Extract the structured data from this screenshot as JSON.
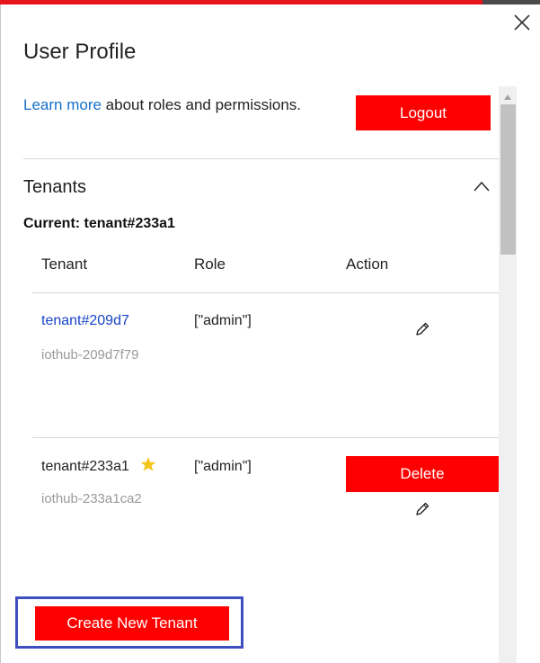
{
  "panel": {
    "title": "User Profile",
    "close_icon": "close-icon",
    "accent_red": "#ff0000",
    "link_blue": "#1570c9"
  },
  "intro": {
    "link_text": "Learn more",
    "text": " about roles and permissions.",
    "logout_label": "Logout"
  },
  "tenants": {
    "section_title": "Tenants",
    "current_label": "Current: tenant#233a1",
    "columns": [
      "Tenant",
      "Role",
      "Action"
    ],
    "rows": [
      {
        "name": "tenant#209d7",
        "hub": "iothub-209d7f79",
        "role": "[\"admin\"]",
        "is_current": false,
        "action_icon": "pencil-icon"
      },
      {
        "name": "tenant#233a1",
        "hub": "iothub-233a1ca2",
        "role": "[\"admin\"]",
        "is_current": true,
        "delete_label": "Delete",
        "action_icon": "pencil-icon",
        "badge_icon": "star-icon"
      }
    ],
    "create_label": "Create New Tenant"
  }
}
